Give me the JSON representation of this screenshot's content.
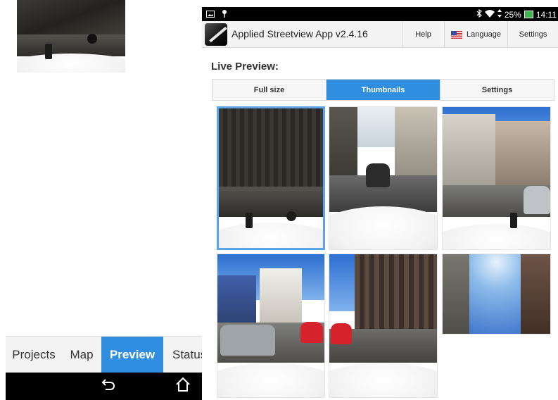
{
  "left_phone": {
    "bottom_tabs": [
      {
        "label": "Projects",
        "active": false
      },
      {
        "label": "Map",
        "active": false
      },
      {
        "label": "Preview",
        "active": true
      },
      {
        "label": "Status",
        "active": false
      }
    ],
    "nav": {
      "back_icon": "back-arrow-icon",
      "home_icon": "home-icon"
    }
  },
  "status_bar": {
    "left_icons": [
      "gallery-icon",
      "location-pin-icon"
    ],
    "right_icons": [
      "bluetooth-icon",
      "wifi-icon",
      "data-arrows-icon",
      "battery-charging-icon"
    ],
    "battery": "25%",
    "time": "14:11"
  },
  "action_bar": {
    "title": "Applied Streetview App v2.4.16",
    "help_label": "Help",
    "language_label": "Language",
    "settings_label": "Settings"
  },
  "live_preview": {
    "heading": "Live Preview:",
    "segments": [
      {
        "label": "Full size",
        "active": false
      },
      {
        "label": "Thumbnails",
        "active": true
      },
      {
        "label": "Settings",
        "active": false
      }
    ],
    "thumbnails": [
      {
        "name": "camera-1",
        "selected": true
      },
      {
        "name": "camera-2",
        "selected": false
      },
      {
        "name": "camera-3",
        "selected": false
      },
      {
        "name": "camera-4",
        "selected": false
      },
      {
        "name": "camera-5",
        "selected": false
      },
      {
        "name": "camera-6",
        "selected": false
      }
    ]
  },
  "colors": {
    "accent": "#2f8ee0",
    "status_bar": "#000000",
    "action_bar": "#f4f4f4",
    "selected_thumb_border": "#5aa5e8",
    "battery": "#3fb34f"
  }
}
